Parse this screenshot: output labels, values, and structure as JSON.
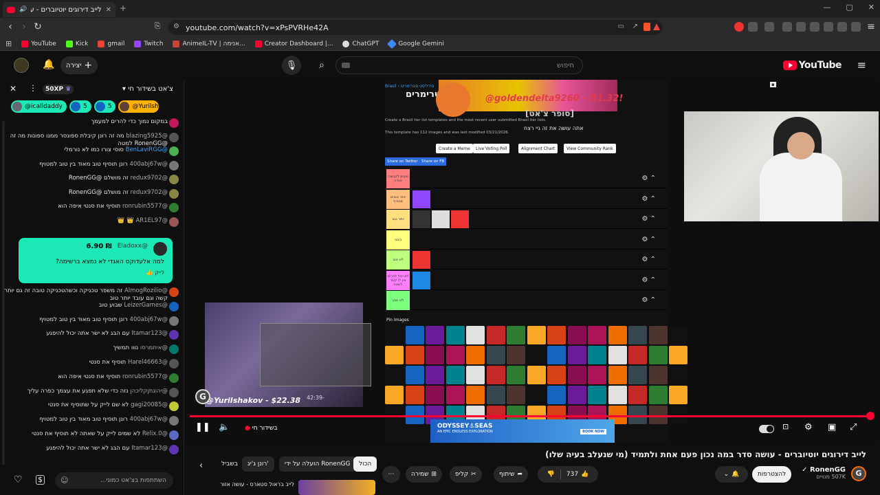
{
  "browser": {
    "tab_title": "לייב דירוגים יוטיוברים - עושה",
    "url": "youtube.com/watch?v=xPsPVRHe42A",
    "bookmarks": [
      {
        "label": "YouTube",
        "color": "#ff0033"
      },
      {
        "label": "Kick",
        "color": "#53fc18"
      },
      {
        "label": "gmail",
        "color": "#ea4335"
      },
      {
        "label": "Twitch",
        "color": "#9146ff"
      },
      {
        "label": "AnimeIL-TV | אנימה...",
        "color": "#c43"
      },
      {
        "label": "Creator Dashboard |...",
        "color": "#ff0033"
      },
      {
        "label": "ChatGPT",
        "color": "#ddd"
      },
      {
        "label": "Google Gemini",
        "color": "#4285f4"
      }
    ]
  },
  "masthead": {
    "logo_text": "YouTube",
    "search_placeholder": "חיפוש",
    "create_label": "יצירה"
  },
  "chat": {
    "header_title": "צ'אט בשידור חי",
    "xp_badge": "50XP",
    "pills": [
      {
        "label": "@icalldaddy",
        "color": "#1de9b6"
      },
      {
        "label": "5",
        "color": "#1de9b6"
      },
      {
        "label": "5",
        "color": "#1de9b6"
      },
      {
        "label": "@Yurilsh",
        "color": "#ffb300"
      }
    ],
    "messages": [
      {
        "name": "",
        "text": "במקום נמוך כדי להרים למעמך",
        "color": "#c2185b"
      },
      {
        "name": "@blazing5925",
        "text": "מה זה רונן קיבלת ספונסר ממנו ספונות מה זה @RonenGG למטה",
        "color": "#555"
      },
      {
        "name": "@BenLaviRGG",
        "text": "סוסי צורו כמו לא נורמלי",
        "color": "#4caf50",
        "name_color": "#3ea6ff"
      },
      {
        "name": "@400abj67w",
        "text": "רונן תוסיף טוב מאוד בין טוב למטויף",
        "color": "#777"
      },
      {
        "name": "@redux9702",
        "text": "זה מושלם @RonenGG",
        "color": "#884"
      },
      {
        "name": "@redux9702",
        "text": "זה מושלם @RonenGG",
        "color": "#884"
      },
      {
        "name": "@ronrubin5577",
        "text": "תוסיף את סנטי איפה הוא",
        "color": "#2e7d32"
      },
      {
        "name": "@AR1EL97",
        "text": "👑 👑",
        "color": "#955"
      }
    ],
    "donation": {
      "name": "@Eladoxx",
      "amount": "₪ 6.90",
      "text": "למה אלעדוקס האגדי לא נמצא ברשימה?",
      "like": "לייק"
    },
    "messages2": [
      {
        "name": "@AlmogRozilio",
        "text": "זה משפר טכניקה וכשהטכניקה טובה זה גם יותר קשה וגם עובד יותר טוב",
        "color": "#d84315"
      },
      {
        "name": "@LeizerGames",
        "text": "שבוע טוב",
        "color": "#1565c0"
      },
      {
        "name": "@400abj67w",
        "text": "רונן תוסיף טוב מאוד בין טוב למטויף",
        "color": "#777"
      },
      {
        "name": "@Itamar123",
        "text": "עם הבג לא ישר אתה יכול להיפגע",
        "color": "#5e35b1"
      },
      {
        "name": "@איתמרסו",
        "text": "נווו תמשיך",
        "color": "#00796b"
      },
      {
        "name": "@Harel46663",
        "text": "תוסיף את סנטי",
        "color": "#555"
      },
      {
        "name": "@ronrubin5577",
        "text": "תוסיף את סנטי איפה הוא",
        "color": "#2e7d32"
      },
      {
        "name": "@יהונתןקליכהן",
        "text": "נזה כדי שלא תפגע את עצמך כפרה עליך",
        "color": "#555"
      },
      {
        "name": "@gagi20085",
        "text": "לא שם לייק על שתוסיף את סנטי",
        "color": "#c0ca33"
      },
      {
        "name": "@400abj67w",
        "text": "רונן תוסיף טוב מאוד בין טוב למטויף",
        "color": "#777"
      },
      {
        "name": "@Relix.0",
        "text": "לא שמים לייק על שאתה לא תוסיף את סנטי",
        "color": "#5c6bc0"
      },
      {
        "name": "@Itamar123",
        "text": "עם הבג לא ישר אתה יכול להיפגע",
        "color": "#5e35b1"
      }
    ],
    "input_placeholder": "השתתפות בצ'אט כמוני..."
  },
  "player": {
    "tier_title": "סטרימרים",
    "tier_subtitle": "This template has 112 images and was last modified 03/21/2026.",
    "tier_info": "Create a Brasil tier list templates and the most recent user submitted Brasil tier lists.",
    "buttons": [
      "Create a Meme",
      "Live Voting Poll",
      "Alignment Chart",
      "View Community Rank"
    ],
    "share": [
      "Share on Twitter",
      "Share on FB"
    ],
    "pin_label": "Pin Images",
    "tiers": [
      {
        "label": "טובים לקבוצה אגדה",
        "color": "#ff7f7f",
        "items": 0
      },
      {
        "label": "יותר טובים מטורף",
        "color": "#ffbf7f",
        "items": 1
      },
      {
        "label": "יותר טוב",
        "color": "#ffdf7f",
        "items": 3
      },
      {
        "label": "בינוני",
        "color": "#ffff7f",
        "items": 0
      },
      {
        "label": "לא טוב",
        "color": "#bfff7f",
        "items": 1
      },
      {
        "label": "לא יכול להרים אין לו קשר לשטח",
        "color": "#ff7fff",
        "items": 1
      },
      {
        "label": "לא נוגע",
        "color": "#7fff7f",
        "items": 0
      }
    ],
    "superchat_text": "[סופר צ'אט]",
    "superchat_name": "@goldendelta9260 - ₪1.32!",
    "caption": "אתה עושה את זה גיי רצח",
    "overlay_donation": "@YuriIshakov - $22.38",
    "time_display": "42:39-",
    "live_label": "בשידור חי",
    "ad_title": "ODYSSEY⚓SEAS",
    "ad_sub": "AN EPIC ENDLESS EXPLORATION",
    "ad_cta": "BOOK NOW"
  },
  "video": {
    "title": "לייב דירוגים יוטיוברים - עושה סדר במה נכון פעם אחת ולתמיד (מי שנעלב בעיה שלו)",
    "channel": "RonenGG",
    "subs": "507K מנויים",
    "join_label": "להצטרפות",
    "likes": "737",
    "share_label": "שיתוף",
    "clip_label": "קליפ",
    "save_label": "שמירה",
    "chips": [
      "הכול",
      "הועלה על ידי RonenGG",
      "רונן ג'יג'",
      "בשביל"
    ],
    "suggestion": "לייב בראול סטארס - עושה אזור"
  }
}
